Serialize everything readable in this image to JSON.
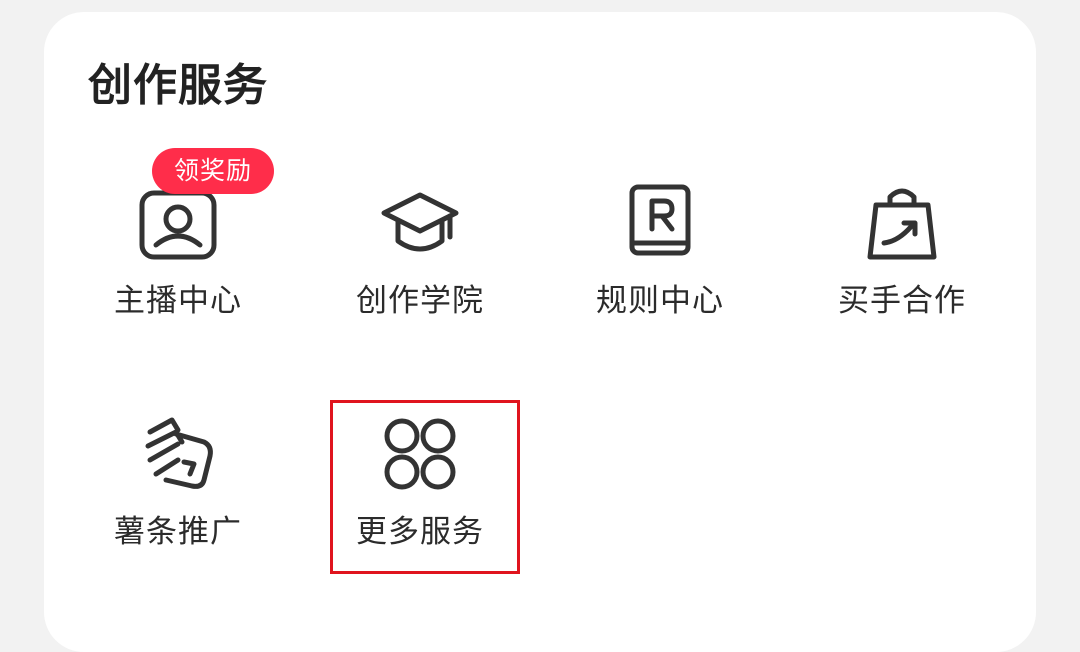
{
  "section": {
    "title": "创作服务"
  },
  "services": [
    {
      "label": "主播中心",
      "icon": "anchor-center-icon",
      "badge": "领奖励"
    },
    {
      "label": "创作学院",
      "icon": "graduation-cap-icon"
    },
    {
      "label": "规则中心",
      "icon": "rulebook-icon"
    },
    {
      "label": "买手合作",
      "icon": "shopping-bag-icon"
    },
    {
      "label": "薯条推广",
      "icon": "fries-promotion-icon"
    },
    {
      "label": "更多服务",
      "icon": "more-services-icon"
    }
  ],
  "colors": {
    "badge_bg": "#ff2d4a",
    "highlight_border": "#e0141e",
    "icon_stroke": "#333333"
  }
}
